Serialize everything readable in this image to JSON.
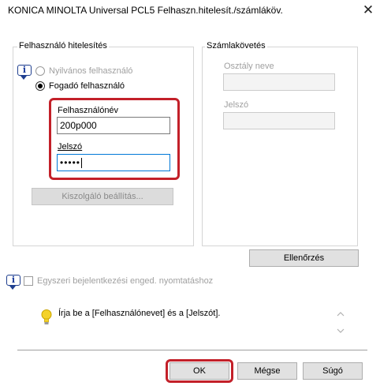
{
  "window": {
    "title": "KONICA MINOLTA Universal PCL5 Felhaszn.hitelesít./számláköv.",
    "close_glyph": "✕"
  },
  "auth_group": {
    "label": "Felhasználó hitelesítés",
    "public_user_label": "Nyilvános felhasználó",
    "recipient_user_label": "Fogadó felhasználó",
    "username_label": "Felhasználónév",
    "username_value": "200p000",
    "password_label": "Jelszó",
    "password_value": "•••••",
    "server_settings_label": "Kiszolgáló beállítás..."
  },
  "account_group": {
    "label": "Számlakövetés",
    "department_label": "Osztály neve",
    "department_value": "",
    "password_label": "Jelszó",
    "password_value": ""
  },
  "verify_button": "Ellenőrzés",
  "single_signon_label": "Egyszeri bejelentkezési enged. nyomtatáshoz",
  "hint_text": "Írja be a [Felhasználónevet] és a [Jelszót].",
  "buttons": {
    "ok": "OK",
    "cancel": "Mégse",
    "help": "Súgó"
  },
  "icons": {
    "info": "info-icon",
    "hint": "lightbulb-icon",
    "scroll_up": "chevron-up-icon",
    "scroll_down": "chevron-down-icon"
  },
  "colors": {
    "highlight": "#c32029",
    "focus": "#0078d7",
    "bulb": "#f4d22a"
  }
}
